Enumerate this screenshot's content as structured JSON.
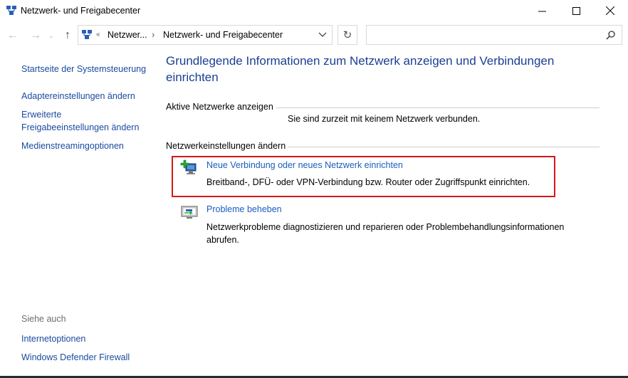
{
  "window": {
    "title": "Netzwerk- und Freigabecenter",
    "icon": "network-center-icon"
  },
  "nav": {
    "back_icon": "arrow-left-icon",
    "forward_icon": "arrow-right-icon",
    "up_icon": "arrow-up-icon",
    "refresh_icon": "refresh-icon",
    "back_glyph": "←",
    "forward_glyph": "→",
    "recent_glyph": "⌄",
    "up_glyph": "↑",
    "refresh_glyph": "↻"
  },
  "address": {
    "chevrons": "«",
    "crumbs": [
      "Netzwer...",
      "Netzwerk- und Freigabecenter"
    ],
    "separator": "›"
  },
  "search": {
    "placeholder": "",
    "icon": "search-icon"
  },
  "sidebar": {
    "links": [
      "Startseite der Systemsteuerung",
      "Adaptereinstellungen ändern",
      "Erweiterte\nFreigabeeinstellungen ändern",
      "Medienstreamingoptionen"
    ],
    "see_also_label": "Siehe auch",
    "see_also_links": [
      "Internetoptionen",
      "Windows Defender Firewall"
    ]
  },
  "main": {
    "title": "Grundlegende Informationen zum Netzwerk anzeigen und Verbindungen einrichten",
    "active_networks_heading": "Aktive Netzwerke anzeigen",
    "no_network_text": "Sie sind zurzeit mit keinem Netzwerk verbunden.",
    "settings_heading": "Netzwerkeinstellungen ändern",
    "tasks": [
      {
        "icon": "new-connection-icon",
        "title": "Neue Verbindung oder neues Netzwerk einrichten",
        "description": "Breitband-, DFÜ- oder VPN-Verbindung bzw. Router oder Zugriffspunkt einrichten.",
        "highlighted": true
      },
      {
        "icon": "troubleshoot-icon",
        "title": "Probleme beheben",
        "description": "Netzwerkprobleme diagnostizieren und reparieren oder Problembehandlungsinformationen abrufen.",
        "highlighted": false
      }
    ]
  },
  "colors": {
    "link": "#1a5dbf",
    "title": "#1b3f94",
    "highlight": "#d6161b"
  }
}
